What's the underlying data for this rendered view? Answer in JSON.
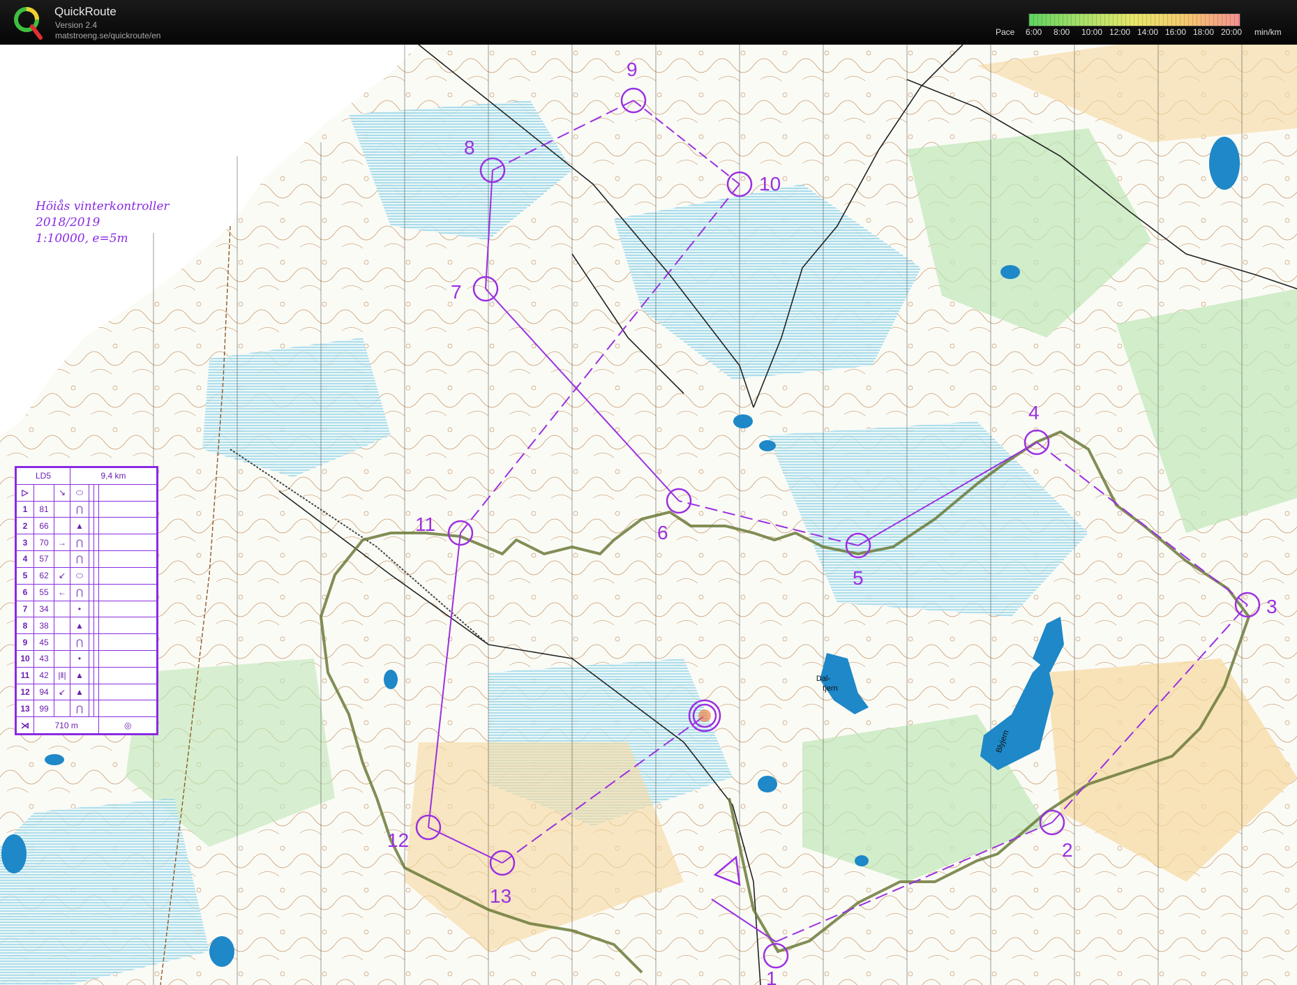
{
  "app": {
    "name": "QuickRoute",
    "version": "Version 2.4",
    "url": "matstroeng.se/quickroute/en"
  },
  "pace": {
    "label": "Pace",
    "ticks": [
      "6:00",
      "8:00",
      "10:00",
      "12:00",
      "14:00",
      "16:00",
      "18:00",
      "20:00"
    ],
    "unit": "min/km",
    "gradient_colors": [
      "#5fd35f",
      "#a8e06a",
      "#e8e86a",
      "#f5c870",
      "#f59090"
    ]
  },
  "map": {
    "title_lines": [
      "Höiås vinterkontroller",
      "2018/2019",
      "1:10000, e=5m"
    ],
    "water_labels": [
      "Dal-",
      "tjern",
      "Blyjern"
    ],
    "controls": [
      {
        "n": "1"
      },
      {
        "n": "2"
      },
      {
        "n": "3"
      },
      {
        "n": "4"
      },
      {
        "n": "5"
      },
      {
        "n": "6"
      },
      {
        "n": "7"
      },
      {
        "n": "8"
      },
      {
        "n": "9"
      },
      {
        "n": "10"
      },
      {
        "n": "11"
      },
      {
        "n": "12"
      },
      {
        "n": "13"
      }
    ],
    "colors": {
      "course": "#9b30e0",
      "route": "#6b7a3a",
      "water": "#1e88c8",
      "open": "#f0c070",
      "forest": "#ffffff",
      "green": "#7fd07f",
      "marsh": "#4fb8d8"
    }
  },
  "legend": {
    "course": "LD5",
    "length": "9,4 km",
    "final_distance": "710 m",
    "rows": [
      {
        "n": "1",
        "code": "81",
        "dir": "",
        "sym": "⋂"
      },
      {
        "n": "2",
        "code": "66",
        "dir": "",
        "sym": "▲"
      },
      {
        "n": "3",
        "code": "70",
        "dir": "→",
        "sym": "⋂"
      },
      {
        "n": "4",
        "code": "57",
        "dir": "",
        "sym": "⋂"
      },
      {
        "n": "5",
        "code": "62",
        "dir": "↙",
        "sym": "⬭"
      },
      {
        "n": "6",
        "code": "55",
        "dir": "←",
        "sym": "⋂"
      },
      {
        "n": "7",
        "code": "34",
        "dir": "",
        "sym": "•"
      },
      {
        "n": "8",
        "code": "38",
        "dir": "",
        "sym": "▲"
      },
      {
        "n": "9",
        "code": "45",
        "dir": "",
        "sym": "⋂"
      },
      {
        "n": "10",
        "code": "43",
        "dir": "",
        "sym": "•"
      },
      {
        "n": "11",
        "code": "42",
        "dir": "|‖|",
        "sym": "▲"
      },
      {
        "n": "12",
        "code": "94",
        "dir": "↙",
        "sym": "▲"
      },
      {
        "n": "13",
        "code": "99",
        "dir": "",
        "sym": "⋂"
      }
    ],
    "start_dir": "↘",
    "start_sym": "⬭"
  }
}
